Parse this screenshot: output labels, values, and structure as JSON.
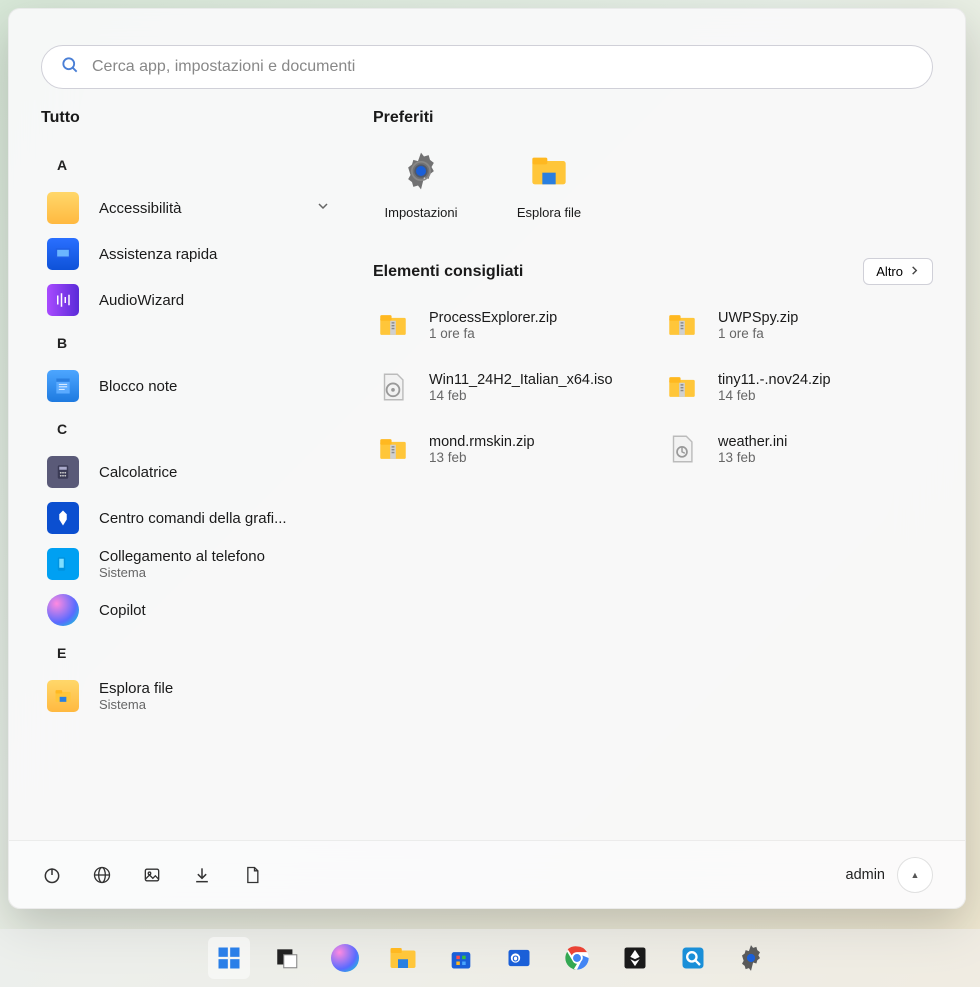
{
  "search": {
    "placeholder": "Cerca app, impostazioni e documenti"
  },
  "sections": {
    "all": "Tutto",
    "pinned": "Preferiti",
    "recommended": "Elementi consigliati",
    "more": "Altro"
  },
  "apps": {
    "letterA": "A",
    "letterB": "B",
    "letterC": "C",
    "letterE": "E",
    "accessibilita": "Accessibilità",
    "assistenza": "Assistenza rapida",
    "audiowizard": "AudioWizard",
    "blocconote": "Blocco note",
    "calcolatrice": "Calcolatrice",
    "centrocomandi": "Centro comandi della grafi...",
    "collegamento": "Collegamento al telefono",
    "collegamento_sub": "Sistema",
    "copilot": "Copilot",
    "esplora": "Esplora file",
    "esplora_sub": "Sistema"
  },
  "pinned": {
    "settings": "Impostazioni",
    "explorer": "Esplora file"
  },
  "recommended": [
    {
      "name": "ProcessExplorer.zip",
      "time": "1 ore fa",
      "icon": "zip"
    },
    {
      "name": "UWPSpy.zip",
      "time": "1 ore fa",
      "icon": "zip"
    },
    {
      "name": "Win11_24H2_Italian_x64.iso",
      "time": "14 feb",
      "icon": "iso"
    },
    {
      "name": "tiny11.-.nov24.zip",
      "time": "14 feb",
      "icon": "zip"
    },
    {
      "name": "mond.rmskin.zip",
      "time": "13 feb",
      "icon": "zip"
    },
    {
      "name": "weather.ini",
      "time": "13 feb",
      "icon": "ini"
    }
  ],
  "user": {
    "name": "admin"
  }
}
